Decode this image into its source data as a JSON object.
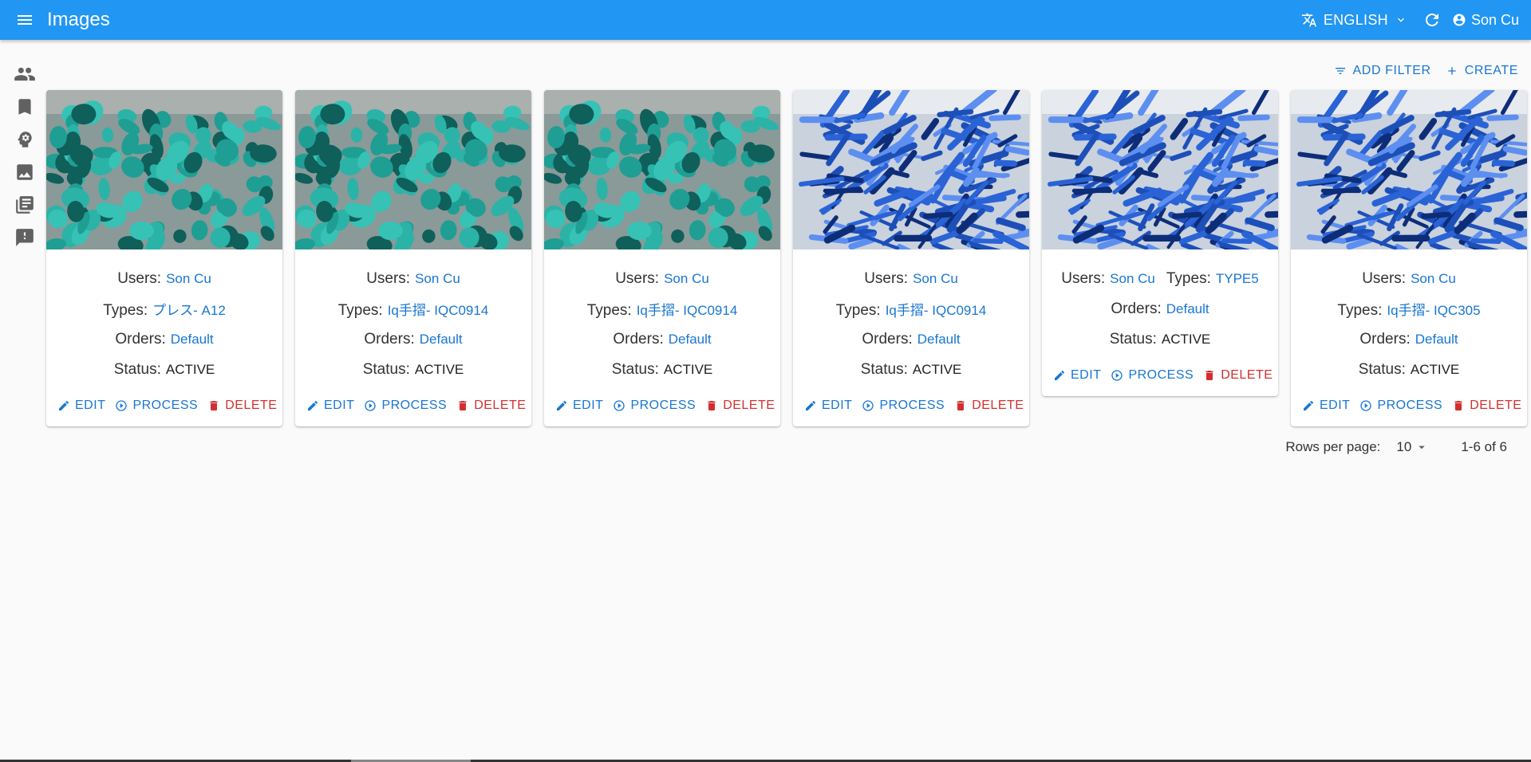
{
  "app": {
    "title": "Images",
    "language": "ENGLISH",
    "user": "Son Cu",
    "colors": {
      "primary": "#2196f3",
      "link": "#1976d2",
      "danger": "#d32f2f"
    }
  },
  "sidebar": {
    "items": [
      {
        "icon": "people-icon"
      },
      {
        "icon": "bookmark-icon"
      },
      {
        "icon": "psychology-icon"
      },
      {
        "icon": "image-icon"
      },
      {
        "icon": "library-books-icon"
      },
      {
        "icon": "feedback-icon"
      }
    ]
  },
  "toolbar": {
    "add_filter": "ADD FILTER",
    "create": "CREATE"
  },
  "labels": {
    "users": "Users:",
    "types": "Types:",
    "orders": "Orders:",
    "status": "Status:",
    "edit": "EDIT",
    "process": "PROCESS",
    "delete": "DELETE"
  },
  "cards": [
    {
      "image": "teal-parts",
      "user": "Son Cu",
      "type": "プレス- A12",
      "order": "Default",
      "status": "ACTIVE"
    },
    {
      "image": "teal-parts",
      "user": "Son Cu",
      "type": "Iq手摺- IQC0914",
      "order": "Default",
      "status": "ACTIVE"
    },
    {
      "image": "teal-parts",
      "user": "Son Cu",
      "type": "Iq手摺- IQC0914",
      "order": "Default",
      "status": "ACTIVE"
    },
    {
      "image": "blue-parts",
      "user": "Son Cu",
      "type": "Iq手摺- IQC0914",
      "order": "Default",
      "status": "ACTIVE"
    },
    {
      "image": "blue-parts",
      "user": "Son Cu",
      "type": "TYPE5",
      "order": "Default",
      "status": "ACTIVE"
    },
    {
      "image": "blue-parts",
      "user": "Son Cu",
      "type": "Iq手摺- IQC305",
      "order": "Default",
      "status": "ACTIVE"
    }
  ],
  "pagination": {
    "rows_label": "Rows per page:",
    "rows_value": "10",
    "range": "1-6 of 6"
  }
}
